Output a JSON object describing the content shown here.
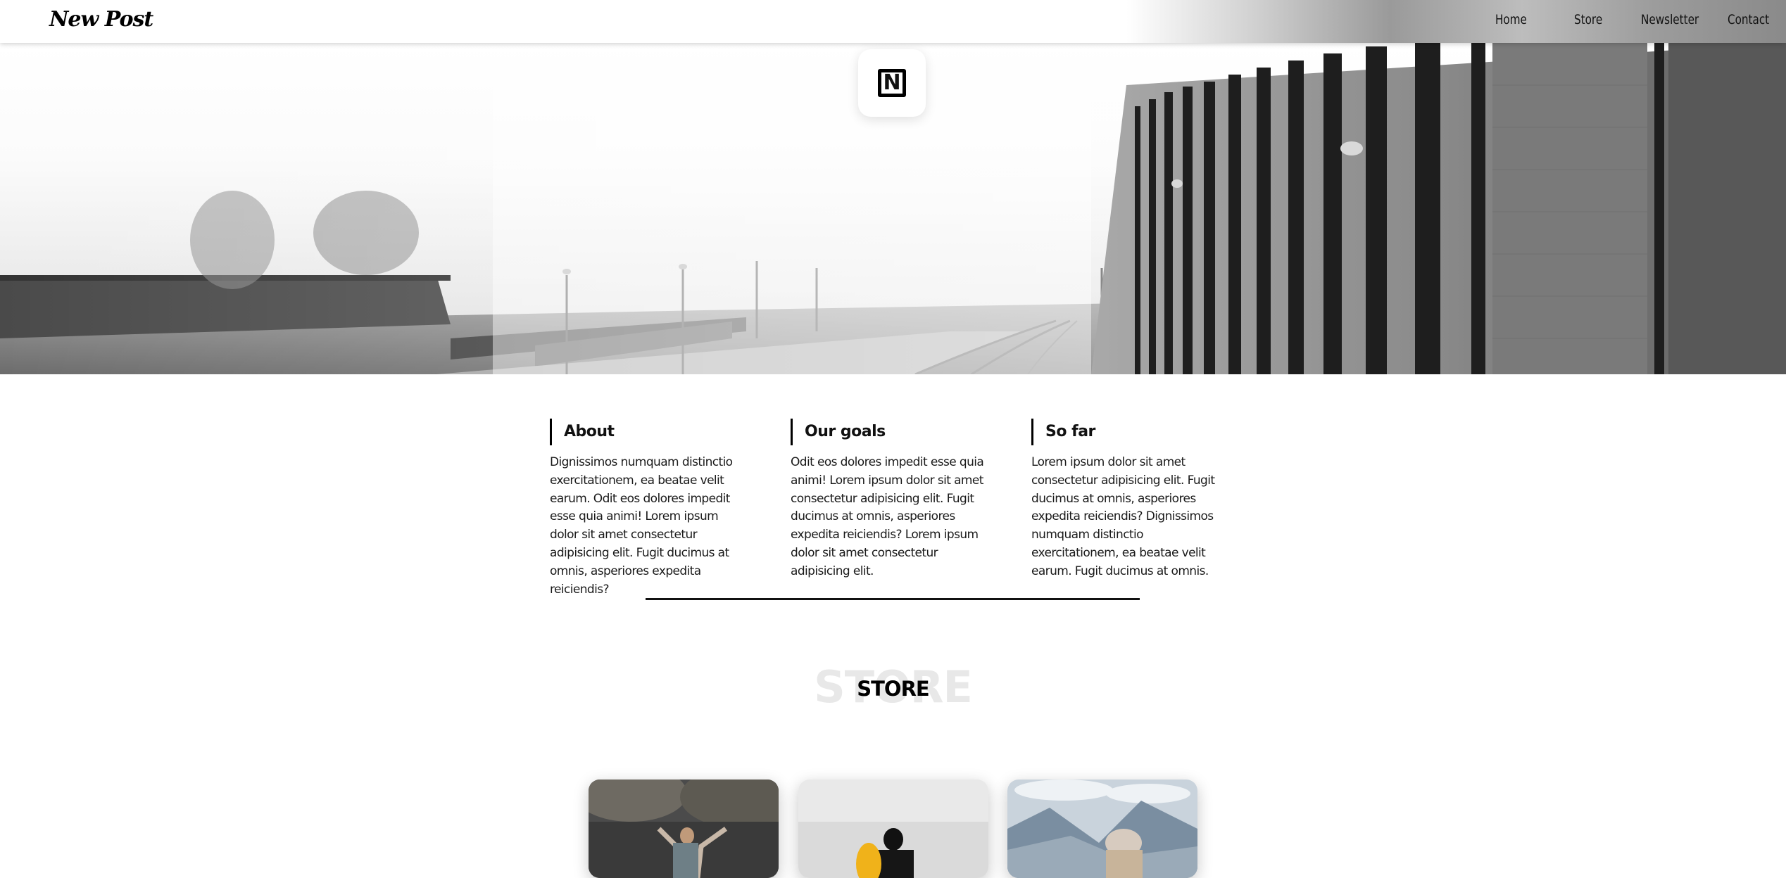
{
  "brand": {
    "logo_text": "New Post"
  },
  "nav": {
    "items": [
      "Home",
      "Store",
      "Newsletter",
      "Contact"
    ]
  },
  "hero": {
    "badge_letter": "N",
    "image": "foggy railway station with brick building"
  },
  "columns": [
    {
      "title": "About",
      "text": "Dignissimos numquam distinctio exercitationem, ea beatae velit earum. Odit eos dolores impedit esse quia animi! Lorem ipsum dolor sit amet consectetur adipisicing elit. Fugit ducimus at omnis, asperiores expedita reiciendis?"
    },
    {
      "title": "Our goals",
      "text": "Odit eos dolores impedit esse quia animi! Lorem ipsum dolor sit amet consectetur adipisicing elit. Fugit ducimus at omnis, asperiores expedita reiciendis? Lorem ipsum dolor sit amet consectetur adipisicing elit."
    },
    {
      "title": "So far",
      "text": "Lorem ipsum dolor sit amet consectetur adipisicing elit. Fugit ducimus at omnis, asperiores expedita reiciendis? Dignissimos numquam distinctio exercitationem, ea beatae velit earum. Fugit ducimus at omnis."
    }
  ],
  "store": {
    "ghost_text": "STORE",
    "title": "STORE",
    "cards": [
      {
        "image": "person with raised arms in front of trees"
      },
      {
        "image": "person holding yellow surfboard by the sea"
      },
      {
        "image": "person with backpack facing mountains"
      }
    ]
  },
  "colors": {
    "text": "#111111",
    "background": "#ffffff",
    "ghost": "#e8e8e8"
  }
}
